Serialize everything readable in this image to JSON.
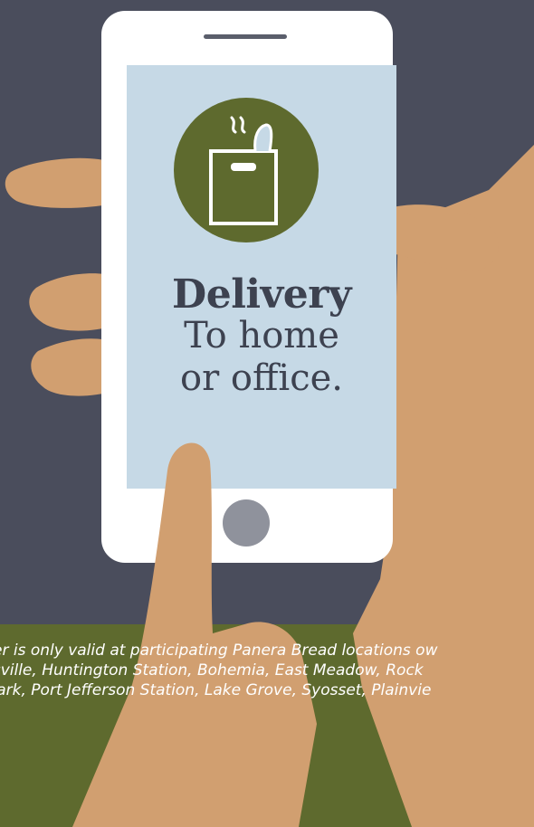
{
  "screen": {
    "title": "Delivery",
    "line2": "To home",
    "line3": "or office."
  },
  "disclaimer": {
    "line1": "er is only valid at participating Panera Bread locations ow",
    "line2": "ksville, Huntington Station, Bohemia, East Meadow, Rock",
    "line3": "Park, Port Jefferson Station, Lake Grove, Syosset, Plainvie"
  },
  "icons": {
    "app_icon": "grocery-bag-icon",
    "home_button": "home-button-icon"
  },
  "colors": {
    "background": "#4a4d5c",
    "ground": "#5e6a2e",
    "skin": "#d19f70",
    "screen": "#c6d9e6",
    "icon_circle": "#5e6a2e",
    "text": "#3d4250"
  }
}
